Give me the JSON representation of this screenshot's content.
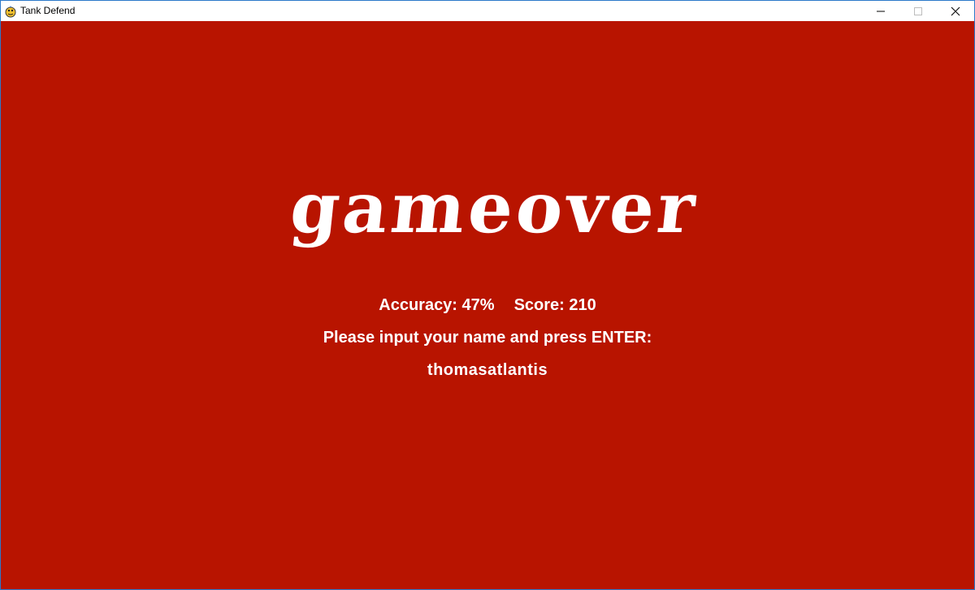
{
  "window": {
    "title": "Tank Defend",
    "app_icon": "pygame-snake-icon",
    "controls": {
      "minimize_icon": "minimize-icon",
      "maximize_icon": "maximize-icon",
      "close_icon": "close-icon"
    }
  },
  "game": {
    "background_color": "#b81400",
    "logo_text": "gameover",
    "stats": {
      "accuracy_label": "Accuracy: 47%",
      "score_label": "Score: 210"
    },
    "prompt": "Please input your name and press ENTER:",
    "name_value": "thomasatlantis"
  }
}
